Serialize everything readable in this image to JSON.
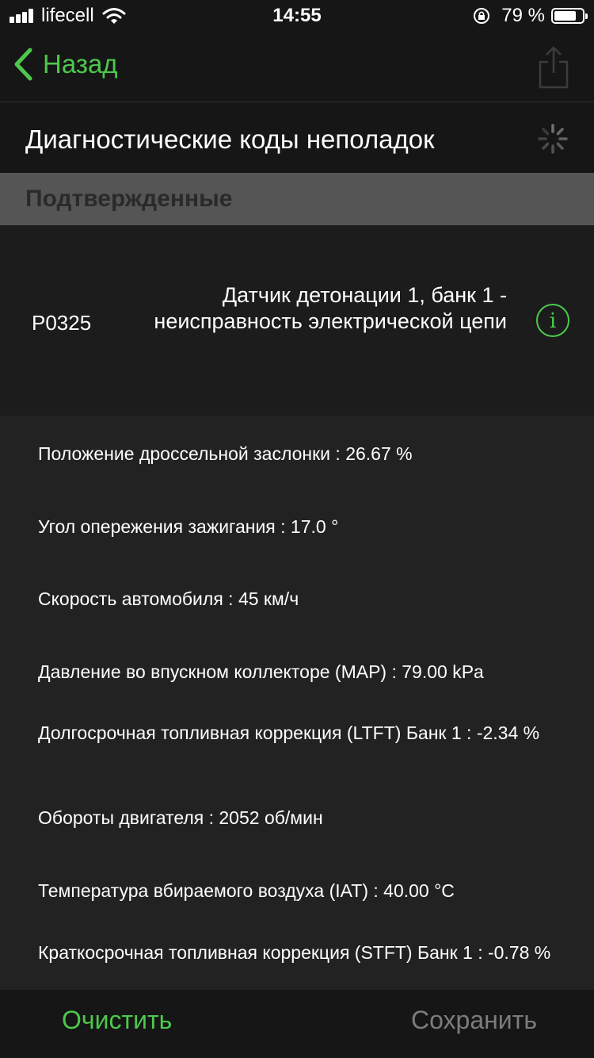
{
  "status_bar": {
    "carrier": "lifecell",
    "time": "14:55",
    "battery_percent": "79 %",
    "battery_level": 0.79
  },
  "nav": {
    "back_label": "Назад"
  },
  "page": {
    "title": "Диагностические коды неполадок"
  },
  "section": {
    "title": "Подтвержденные"
  },
  "dtc": {
    "code": "P0325",
    "description": "Датчик детонации 1, банк 1 - неисправность электрической цепи"
  },
  "parameters": [
    {
      "label": "Положение дроссельной заслонки : 26.67 %"
    },
    {
      "label": "Угол опережения зажигания : 17.0 °"
    },
    {
      "label": "Скорость автомобиля : 45 км/ч"
    },
    {
      "label": "Давление во впускном коллекторе (MAP) : 79.00 kPa"
    },
    {
      "label": "Долгосрочная топливная коррекция (LTFT) Банк 1 : -2.34 %"
    },
    {
      "label": "Обороты двигателя : 2052 об/мин"
    },
    {
      "label": "Температура вбираемого воздуха (IAT) : 40.00 °C"
    },
    {
      "label": "Краткосрочная топливная коррекция (STFT) Банк 1 : -0.78 %"
    }
  ],
  "toolbar": {
    "clear_label": "Очистить",
    "save_label": "Сохранить"
  },
  "colors": {
    "accent": "#4cc94c",
    "background": "#222222",
    "bar": "#161616",
    "section_header": "#555555",
    "disabled": "#7c7c7c"
  },
  "icons": {
    "back": "chevron-left-icon",
    "share": "share-icon",
    "spinner": "loading-spinner-icon",
    "info": "info-icon",
    "lock": "rotation-lock-icon",
    "wifi": "wifi-icon",
    "signal": "signal-icon",
    "battery": "battery-icon"
  }
}
